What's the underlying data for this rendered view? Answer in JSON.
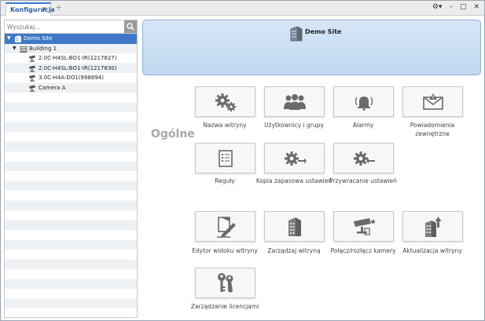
{
  "tab": {
    "label": "Konfiguracja",
    "close": "✕",
    "add": "+"
  },
  "window_controls": {
    "settings": "⚙▾",
    "minimize": "–",
    "maximize": "□",
    "close": "✕"
  },
  "search": {
    "placeholder": "Wyszukaj..."
  },
  "tree": [
    {
      "label": "Demo Site",
      "level": 0,
      "selected": true,
      "icon": "site-icon",
      "expanded": true
    },
    {
      "label": "Building 1",
      "level": 1,
      "selected": false,
      "icon": "building-icon",
      "expanded": true
    },
    {
      "label": "2.0C-H4SL-BO1-IR(1217827)",
      "level": 2,
      "selected": false,
      "icon": "camera-icon"
    },
    {
      "label": "2.0C-H4SL-BO1-IR(1217830)",
      "level": 2,
      "selected": false,
      "icon": "camera-icon"
    },
    {
      "label": "3.0C-H4A-DO1(998894)",
      "level": 2,
      "selected": false,
      "icon": "camera-icon"
    },
    {
      "label": "Camera A",
      "level": 2,
      "selected": false,
      "icon": "camera-icon"
    }
  ],
  "banner": {
    "title": "Demo Site",
    "icon": "site-icon"
  },
  "section": {
    "title": "Ogólne"
  },
  "tiles": {
    "site_name": {
      "label": "Nazwa witryny",
      "icon": "gears-icon"
    },
    "users_groups": {
      "label": "Użytkownicy i grupy",
      "icon": "users-icon"
    },
    "alarms": {
      "label": "Alarmy",
      "icon": "alarm-bell-icon"
    },
    "notifications": {
      "label": "Powiadomienia zewnętrzne",
      "icon": "envelope-alert-icon"
    },
    "rules": {
      "label": "Reguły",
      "icon": "checklist-icon"
    },
    "backup": {
      "label": "Kopia zapasowa ustawień",
      "icon": "gear-export-icon"
    },
    "restore": {
      "label": "Przywracanie ustawień",
      "icon": "gear-import-icon"
    },
    "view_editor": {
      "label": "Edytor widoku witryny",
      "icon": "pen-edit-icon"
    },
    "manage_site": {
      "label": "Zarządzaj witryną",
      "icon": "building-icon"
    },
    "connect_camera": {
      "label": "Połącz/rozłącz kamery",
      "icon": "camera-connect-icon"
    },
    "site_update": {
      "label": "Aktualizacja witryny",
      "icon": "building-upload-icon"
    },
    "license": {
      "label": "Zarządzanie licencjami",
      "icon": "keys-icon"
    }
  }
}
